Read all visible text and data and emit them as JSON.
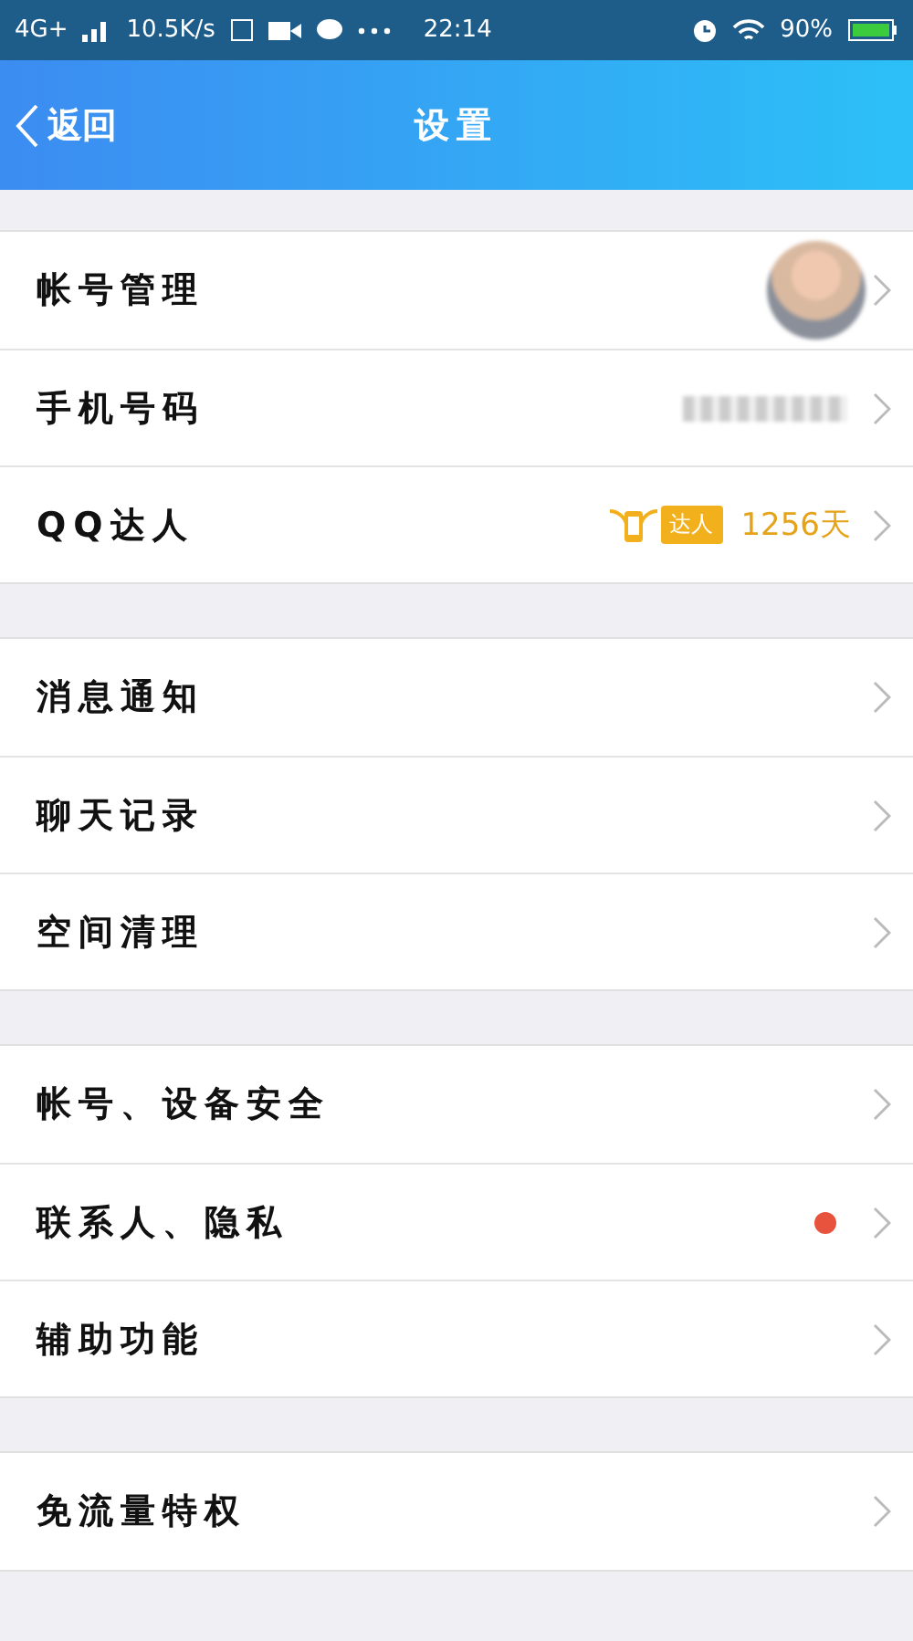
{
  "status_bar": {
    "network": "4G+",
    "speed": "10.5K/s",
    "time": "22:14",
    "battery": "90%"
  },
  "header": {
    "back": "返回",
    "title": "设置"
  },
  "groups": [
    {
      "items": [
        {
          "label": "帐号管理"
        },
        {
          "label": "手机号码",
          "kind": "hidden"
        },
        {
          "label": "QQ达人",
          "kind": "badge",
          "badge": "达人",
          "value": "1256天"
        }
      ]
    },
    {
      "items": [
        {
          "label": "消息通知",
          "kind": "plain"
        },
        {
          "label": "聊天记录",
          "kind": "plain"
        },
        {
          "label": "空间清理",
          "kind": "plain"
        }
      ]
    },
    {
      "items": [
        {
          "label": "帐号、设备安全",
          "kind": "plain"
        },
        {
          "label": "联系人、隐私",
          "kind": "dot",
          "color": "#e8533d"
        },
        {
          "label": "辅助功能",
          "kind": "plain"
        }
      ]
    },
    {
      "items": [
        {
          "label": "免流量特权",
          "kind": "plain"
        }
      ]
    }
  ]
}
